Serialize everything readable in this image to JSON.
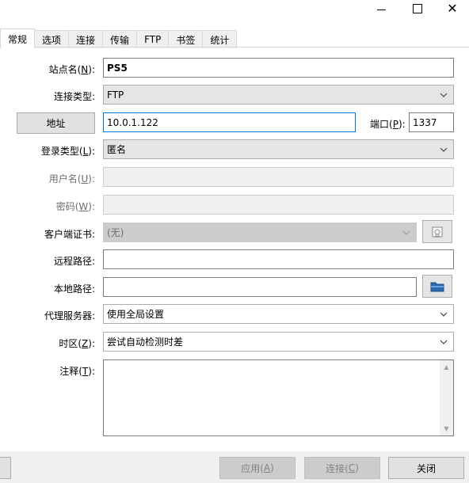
{
  "window": {
    "minimize_glyph": "—",
    "close_glyph": "✕"
  },
  "tabs": [
    {
      "label": "常规"
    },
    {
      "label": "选项"
    },
    {
      "label": "连接"
    },
    {
      "label": "传输"
    },
    {
      "label": "FTP"
    },
    {
      "label": "书签"
    },
    {
      "label": "统计"
    }
  ],
  "form": {
    "site_name": {
      "label_pre": "站点名(",
      "key": "N",
      "label_post": "):",
      "value": "PS5"
    },
    "conn_type": {
      "label": "连接类型:",
      "value": "FTP"
    },
    "address": {
      "button_label": "地址",
      "value": "10.0.1.122"
    },
    "port": {
      "label_pre": "端口(",
      "key": "P",
      "label_post": "):",
      "value": "1337"
    },
    "login_type": {
      "label_pre": "登录类型(",
      "key": "L",
      "label_post": "):",
      "value": "匿名"
    },
    "username": {
      "label_pre": "用户名(",
      "key": "U",
      "label_post": "):",
      "value": ""
    },
    "password": {
      "label_pre": "密码(",
      "key": "W",
      "label_post": "):",
      "value": ""
    },
    "client_cert": {
      "label": "客户端证书:",
      "value": "(无)"
    },
    "remote_path": {
      "label": "远程路径:",
      "value": ""
    },
    "local_path": {
      "label": "本地路径:",
      "value": ""
    },
    "proxy": {
      "label": "代理服务器:",
      "value": "使用全局设置"
    },
    "timezone": {
      "label_pre": "时区(",
      "key": "Z",
      "label_post": "):",
      "value": "尝试自动检测时差"
    },
    "notes": {
      "label_pre": "注释(",
      "key": "T",
      "label_post": "):",
      "value": ""
    }
  },
  "footer": {
    "apply_pre": "应用(",
    "apply_key": "A",
    "apply_post": ")",
    "connect_pre": "连接(",
    "connect_key": "C",
    "connect_post": ")",
    "close_label": "关闭"
  },
  "colors": {
    "focus_border": "#0078d7",
    "folder_icon": "#2b6cb0"
  }
}
